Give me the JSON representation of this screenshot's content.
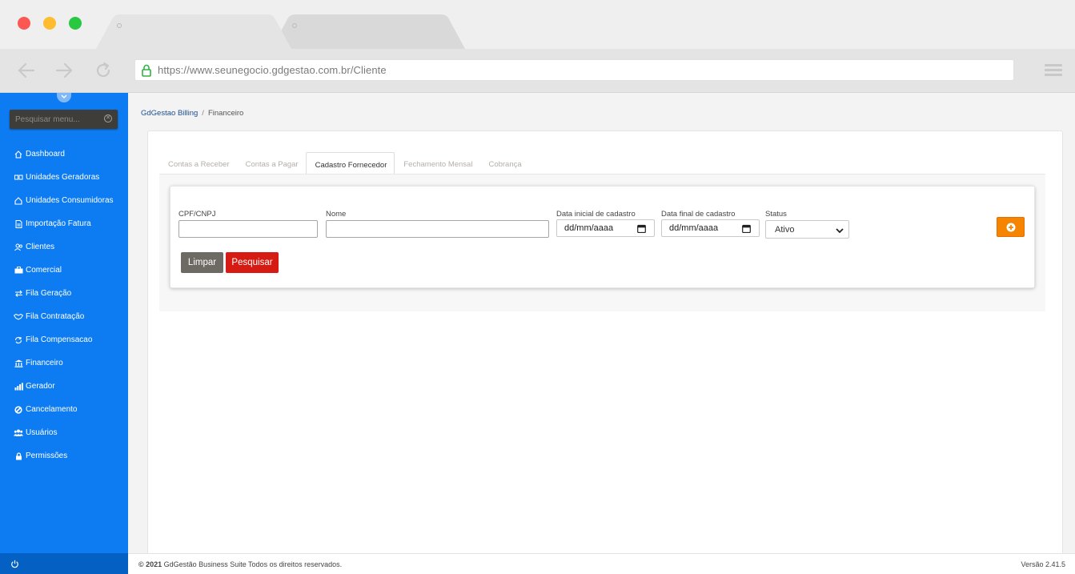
{
  "browser": {
    "url": "https://www.seunegocio.gdgestao.com.br/Cliente"
  },
  "sidebar": {
    "search_placeholder": "Pesquisar menu...",
    "items": [
      {
        "label": "Dashboard",
        "icon": "home-icon"
      },
      {
        "label": "Unidades Geradoras",
        "icon": "generator-icon"
      },
      {
        "label": "Unidades Consumidoras",
        "icon": "house-icon"
      },
      {
        "label": "Importação Fatura",
        "icon": "file-icon"
      },
      {
        "label": "Clientes",
        "icon": "users-icon"
      },
      {
        "label": "Comercial",
        "icon": "briefcase-icon"
      },
      {
        "label": "Fila Geração",
        "icon": "exchange-icon"
      },
      {
        "label": "Fila Contratação",
        "icon": "handshake-icon"
      },
      {
        "label": "Fila Compensacao",
        "icon": "sync-icon"
      },
      {
        "label": "Financeiro",
        "icon": "bank-icon"
      },
      {
        "label": "Gerador",
        "icon": "signal-icon"
      },
      {
        "label": "Cancelamento",
        "icon": "ban-icon"
      },
      {
        "label": "Usuários",
        "icon": "group-icon"
      },
      {
        "label": "Permissões",
        "icon": "lock-icon"
      }
    ]
  },
  "breadcrumb": {
    "root": "GdGestao Billing",
    "separator": "/",
    "current": "Financeiro"
  },
  "tabs": [
    {
      "label": "Contas a Receber",
      "active": false
    },
    {
      "label": "Contas a Pagar",
      "active": false
    },
    {
      "label": "Cadastro Fornecedor",
      "active": true
    },
    {
      "label": "Fechamento Mensal",
      "active": false
    },
    {
      "label": "Cobrança",
      "active": false
    }
  ],
  "filters": {
    "cpf_label": "CPF/CNPJ",
    "cpf_value": "",
    "nome_label": "Nome",
    "nome_value": "",
    "data_inicial_label": "Data inicial de cadastro",
    "data_inicial_value": "dd/mm/aaaa",
    "data_final_label": "Data final de cadastro",
    "data_final_value": "dd/mm/aaaa",
    "status_label": "Status",
    "status_value": "Ativo"
  },
  "buttons": {
    "clear": "Limpar",
    "search": "Pesquisar"
  },
  "footer": {
    "copyright_bold": "© 2021",
    "copyright_text": " GdGestão Business Suite Todos os direitos reservados.",
    "version": "Versão 2.41.5"
  },
  "colors": {
    "sidebar": "#0d7cf2",
    "sidebar_bottom": "#0560c4",
    "accent_orange": "#f58400",
    "danger_red": "#d51b12",
    "neutral_button": "#6d6963"
  }
}
